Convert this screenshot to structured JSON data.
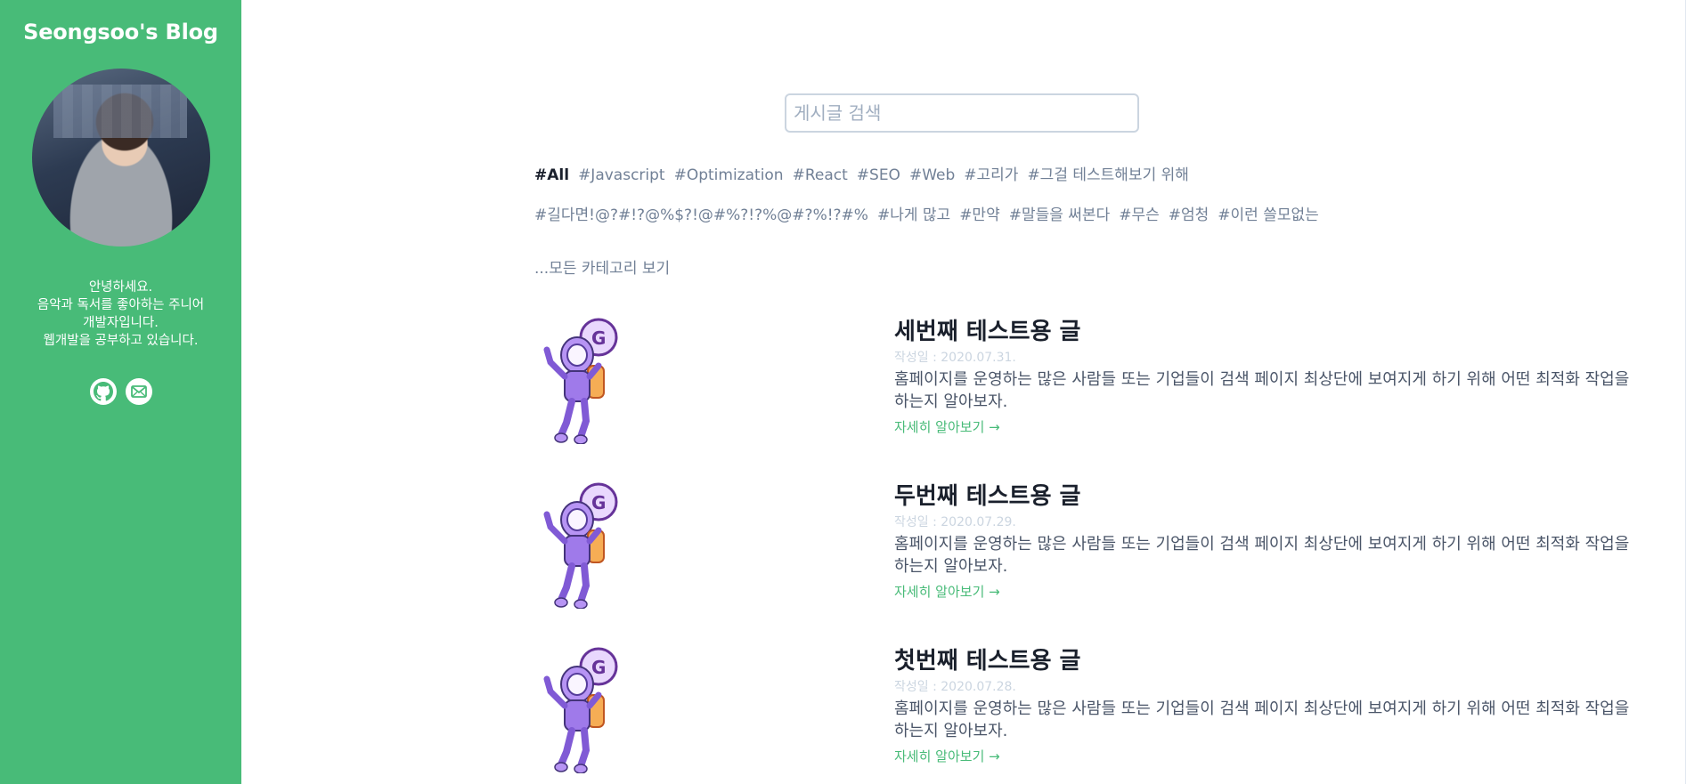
{
  "sidebar": {
    "title": "Seongsoo's Blog",
    "bio": [
      "안녕하세요.",
      "음악과 독서를 좋아하는 주니어",
      "개발자입니다.",
      "웹개발을 공부하고 있습니다."
    ],
    "social": [
      {
        "icon": "github-icon"
      },
      {
        "icon": "mail-icon"
      }
    ],
    "colors": {
      "accent": "#48bb78"
    }
  },
  "search": {
    "placeholder": "게시글 검색"
  },
  "tags": {
    "row1": [
      "#All",
      "#Javascript",
      "#Optimization",
      "#React",
      "#SEO",
      "#Web",
      "#고리가",
      "#그걸 테스트해보기 위해"
    ],
    "row2": [
      "#길다면!@?#!?@%$?!@#%?!?%@#?%!?#%",
      "#나게 많고",
      "#만약",
      "#말들을 써본다",
      "#무슨",
      "#엄청",
      "#이런 쓸모없는"
    ],
    "active": "#All"
  },
  "all_categories": "...모든 카테고리 보기",
  "posts": [
    {
      "title": "세번째 테스트용 글",
      "date": "작성일 : 2020.07.31.",
      "desc": "홈페이지를 운영하는 많은 사람들 또는 기업들이 검색 페이지 최상단에 보여지게 하기 위해 어떤 최적화 작업을 하는지 알아보자.",
      "more": "자세히 알아보기 →"
    },
    {
      "title": "두번째 테스트용 글",
      "date": "작성일 : 2020.07.29.",
      "desc": "홈페이지를 운영하는 많은 사람들 또는 기업들이 검색 페이지 최상단에 보여지게 하기 위해 어떤 최적화 작업을 하는지 알아보자.",
      "more": "자세히 알아보기 →"
    },
    {
      "title": "첫번째 테스트용 글",
      "date": "작성일 : 2020.07.28.",
      "desc": "홈페이지를 운영하는 많은 사람들 또는 기업들이 검색 페이지 최상단에 보여지게 하기 위해 어떤 최적화 작업을 하는지 알아보자.",
      "more": "자세히 알아보기 →"
    }
  ]
}
